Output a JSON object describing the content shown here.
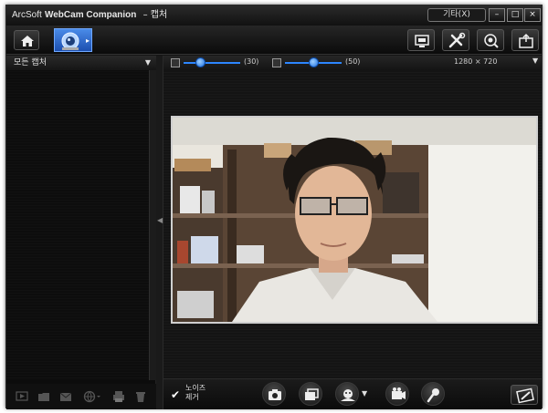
{
  "window": {
    "title_brand": "ArcSoft",
    "title_product": "WebCam Companion",
    "title_section": "– 캡처",
    "more_label": "기타(X)",
    "minimize_label": "–",
    "maximize_label": "□",
    "close_label": "×"
  },
  "toolbar": {
    "icons": [
      "home-icon",
      "webcam-icon",
      "screen-icon",
      "tools-icon",
      "webcam-monitor-icon",
      "export-icon"
    ]
  },
  "left_panel": {
    "category_label": "모든 캡처",
    "dropdown_arrow": "▼",
    "bottom_icons": [
      "play-icon",
      "folder-icon",
      "mail-icon",
      "web-icon",
      "print-icon",
      "trash-icon"
    ]
  },
  "controls": {
    "brightness_value": "(30)",
    "contrast_value": "(50)",
    "brightness_level": 30,
    "contrast_level": 50,
    "resolution": "1280 × 720",
    "resolution_arrow": "▼"
  },
  "bottom_bar": {
    "noise_checked": "✔",
    "noise_label": "노이즈 제거",
    "effects_arrow": "▼"
  },
  "colors": {
    "accent": "#2d86ff",
    "tab_blue": "#3a78d8",
    "background": "#141414"
  }
}
